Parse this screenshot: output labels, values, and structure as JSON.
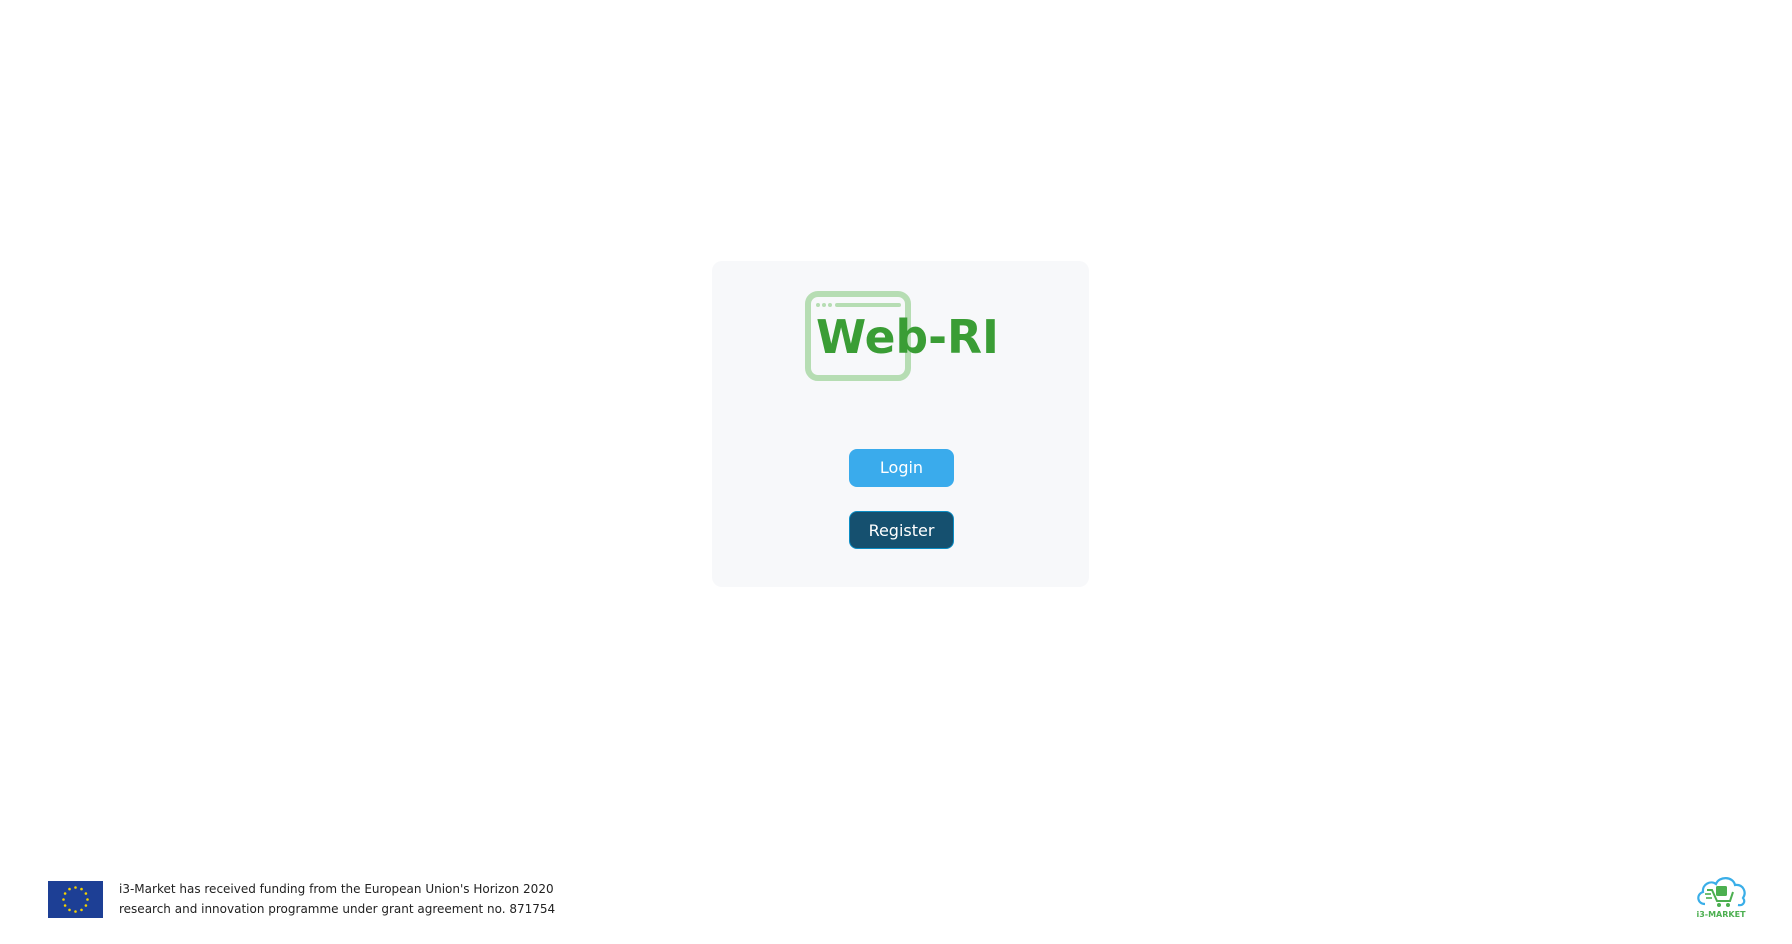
{
  "logo": {
    "text": "Web-RI",
    "color": "#3a9d35",
    "frame_color": "#b6ddb3"
  },
  "actions": {
    "login_label": "Login",
    "register_label": "Register",
    "login_color": "#3aabec",
    "register_color": "#15506f"
  },
  "footer": {
    "funding_line1": "i3-Market has received funding from the European Union's Horizon 2020",
    "funding_line2": "research and innovation programme under grant agreement no. 871754",
    "eu_flag_icon": "eu-flag-icon",
    "partner_logo_text": "i3-MARKET"
  }
}
